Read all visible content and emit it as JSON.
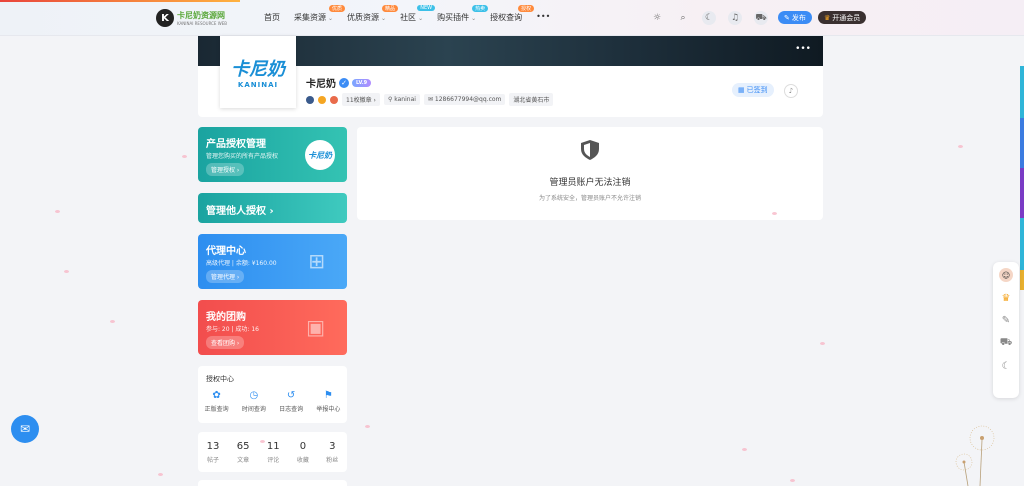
{
  "header": {
    "logo_text": "卡尼奶资源网",
    "logo_sub": "KANINAI RESOURCE WEB",
    "nav": [
      {
        "label": "首页",
        "badge": "",
        "caret": false
      },
      {
        "label": "采集资源",
        "badge": "优质",
        "badge_color": "#ff8a3c",
        "caret": true
      },
      {
        "label": "优质资源",
        "badge": "精品",
        "badge_color": "#ff8a3c",
        "caret": true
      },
      {
        "label": "社区",
        "badge": "NEW",
        "badge_color": "#3cc0e8",
        "caret": true
      },
      {
        "label": "购买插件",
        "badge": "热卖",
        "badge_color": "#3cc0e8",
        "caret": true
      },
      {
        "label": "授权查询",
        "badge": "授权",
        "badge_color": "#ff8a3c",
        "caret": false
      },
      {
        "label": "•••",
        "badge": "",
        "caret": false
      }
    ],
    "publish_label": "发布",
    "vip_label": "开通会员"
  },
  "profile": {
    "avatar_cn": "卡尼奶",
    "avatar_en": "KANINAI",
    "name": "卡尼奶",
    "level": "LV.9",
    "badges_count": "11枚徽章",
    "username": "kaninai",
    "email": "1286677994@qq.com",
    "location": "湖北省黄石市",
    "checkin_label": "已签到"
  },
  "cards": {
    "product": {
      "title": "产品授权管理",
      "sub": "管理您购买的所有产品授权",
      "button": "管理授权",
      "logo": "卡尼奶"
    },
    "others": {
      "title": "管理他人授权"
    },
    "agent": {
      "title": "代理中心",
      "sub": "高级代理 | 余额: ¥160.00",
      "button": "管理代理"
    },
    "group": {
      "title": "我的团购",
      "sub": "参与: 20 | 成功: 16",
      "button": "查看团购"
    }
  },
  "auth_center": {
    "title": "授权中心",
    "items": [
      {
        "label": "正版查询",
        "icon": "✿"
      },
      {
        "label": "时间查询",
        "icon": "◷"
      },
      {
        "label": "日志查询",
        "icon": "↺"
      },
      {
        "label": "举报中心",
        "icon": "⚑"
      }
    ]
  },
  "stats": [
    {
      "num": "13",
      "label": "帖子"
    },
    {
      "num": "65",
      "label": "文章"
    },
    {
      "num": "11",
      "label": "评论"
    },
    {
      "num": "0",
      "label": "收藏"
    },
    {
      "num": "3",
      "label": "粉丝"
    }
  ],
  "notice": {
    "title": "管理员账户无法注销",
    "sub": "为了系统安全，管理员账户不允许注销"
  },
  "colors": {
    "accent": "#3b8cf5",
    "teal": "#1aa3a0",
    "red": "#f24d4d"
  }
}
